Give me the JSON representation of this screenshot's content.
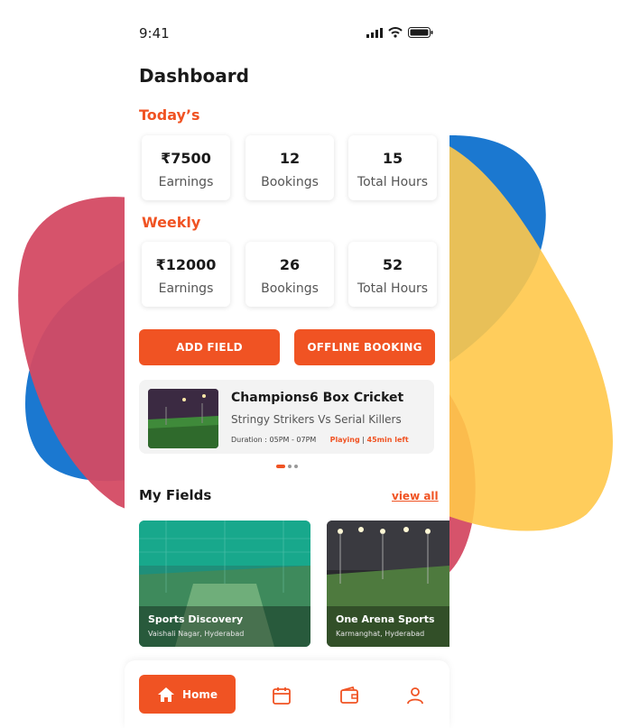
{
  "status_bar": {
    "time": "9:41"
  },
  "page_title": "Dashboard",
  "today": {
    "label": "Today’s",
    "stats": [
      {
        "value": "₹7500",
        "label": "Earnings"
      },
      {
        "value": "12",
        "label": "Bookings"
      },
      {
        "value": "15",
        "label": "Total Hours"
      }
    ]
  },
  "weekly": {
    "label": "Weekly",
    "stats": [
      {
        "value": "₹12000",
        "label": "Earnings"
      },
      {
        "value": "26",
        "label": "Bookings"
      },
      {
        "value": "52",
        "label": "Total Hours"
      }
    ]
  },
  "actions": {
    "add_field": "ADD FIELD",
    "offline_booking": "OFFLINE BOOKING"
  },
  "live_booking": {
    "title": "Champions6 Box Cricket",
    "match": "Stringy Strikers Vs Serial Killers",
    "duration": "Duration : 05PM - 07PM",
    "status": "Playing",
    "separator": "|",
    "time_left": "45min left"
  },
  "my_fields": {
    "heading": "My Fields",
    "view_all": "view all",
    "items": [
      {
        "name": "Sports Discovery",
        "location": "Vaishali Nagar, Hyderabad"
      },
      {
        "name": "One Arena Sports",
        "location": "Karmanghat, Hyderabad"
      }
    ]
  },
  "bottom_nav": {
    "home_label": "Home",
    "items": [
      "home-icon",
      "calendar-icon",
      "wallet-icon",
      "profile-icon"
    ]
  },
  "colors": {
    "accent": "#f05323",
    "blob_blue": "#1b78d0",
    "blob_red": "#d44a63",
    "blob_yellow": "#ffc84a"
  }
}
